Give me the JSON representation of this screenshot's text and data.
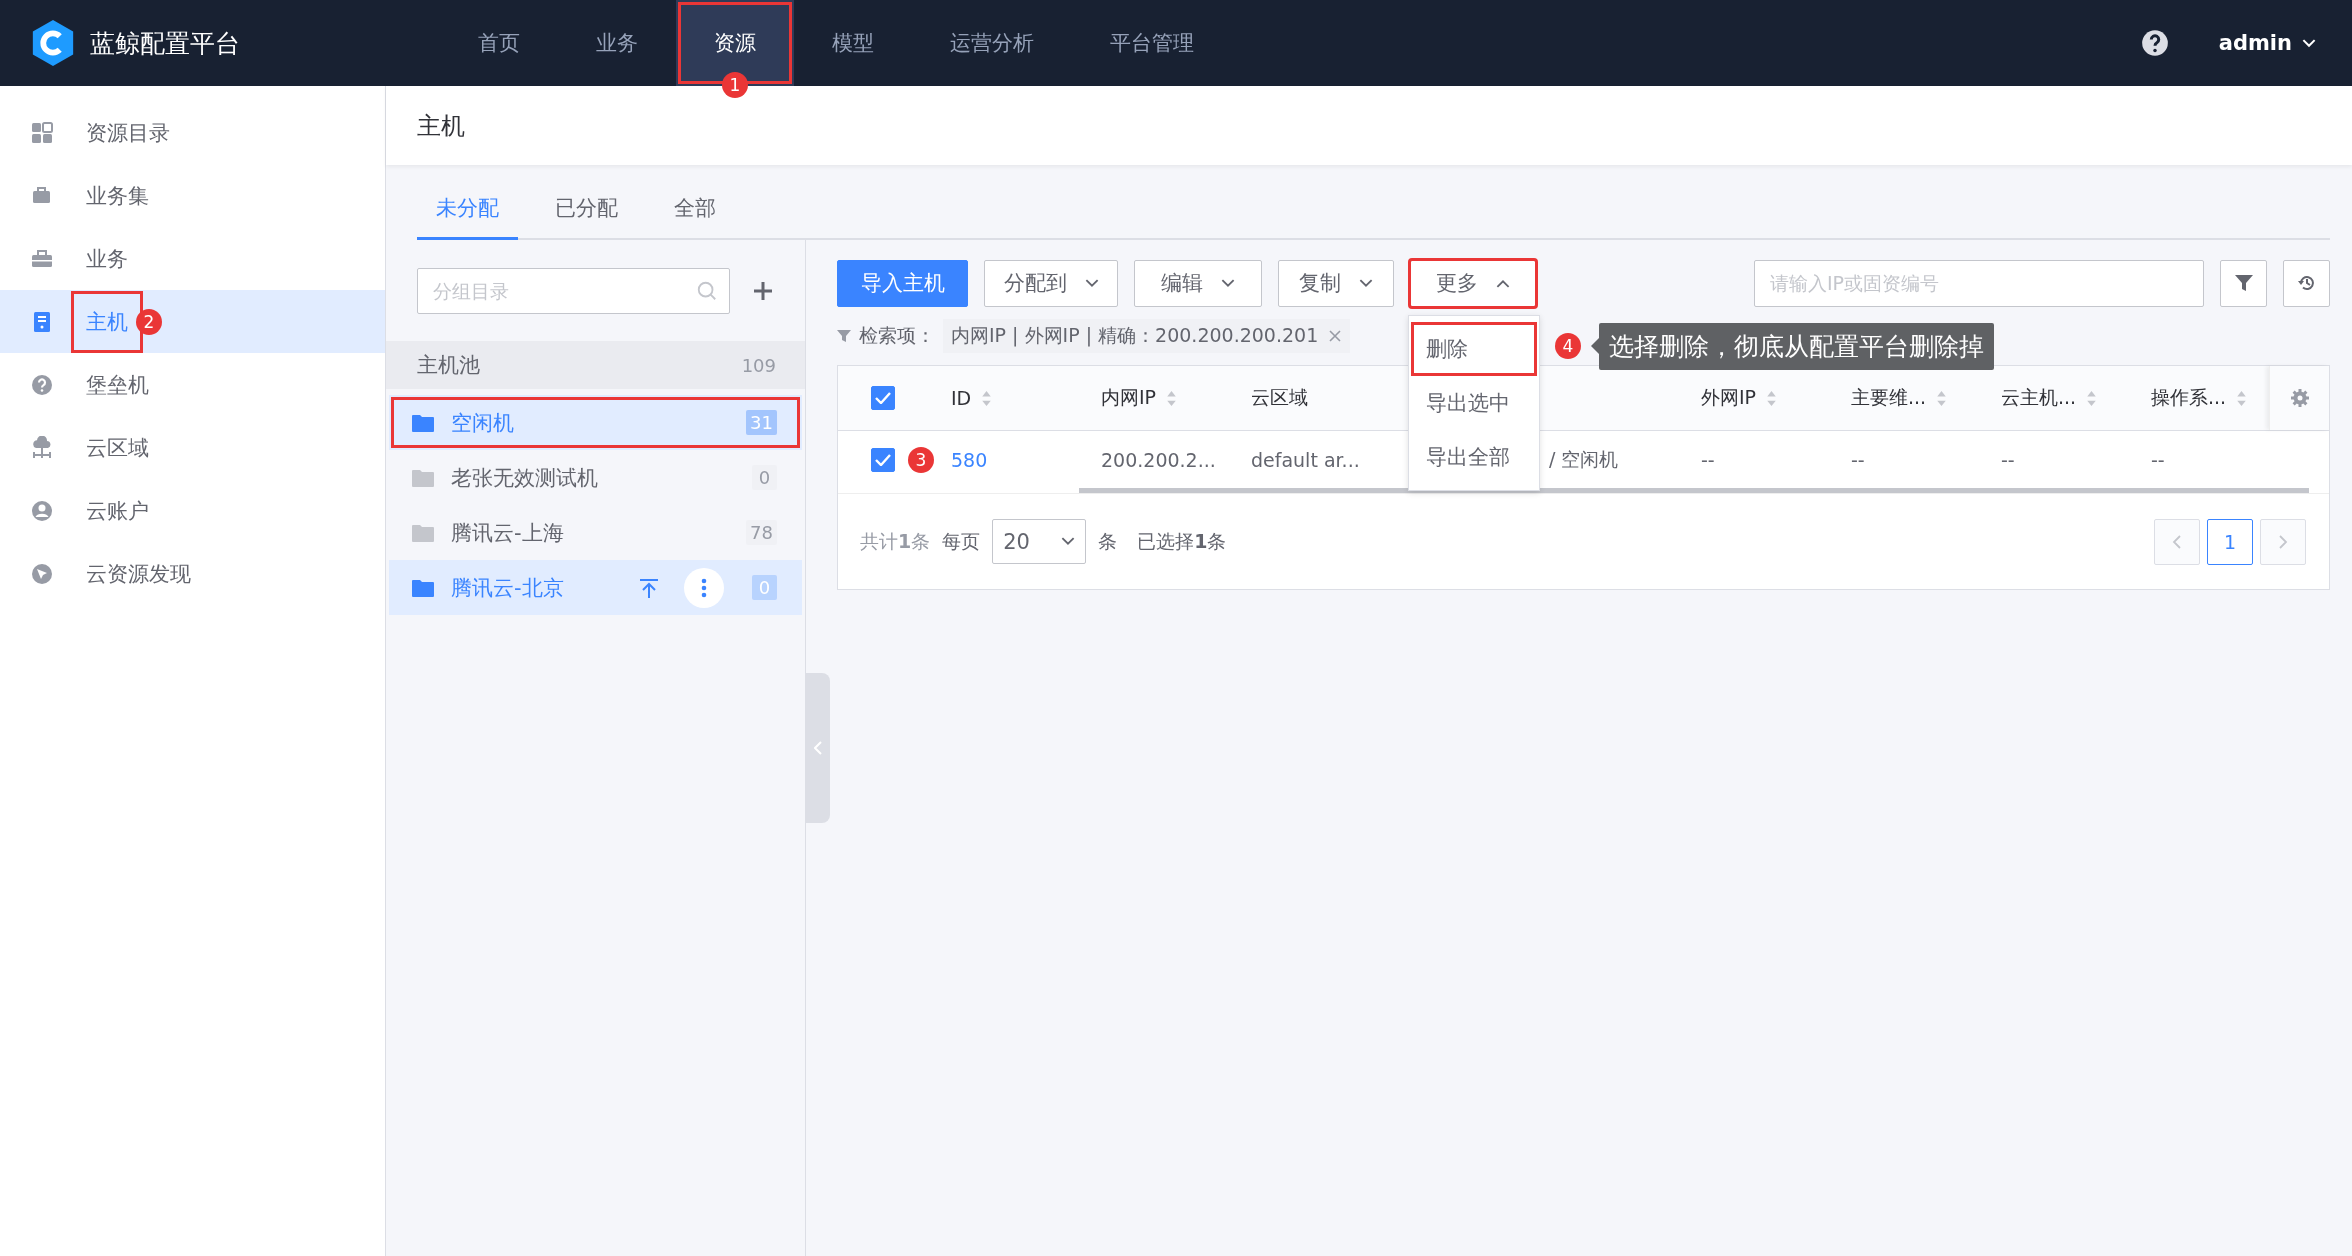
{
  "brand": {
    "title": "蓝鲸配置平台"
  },
  "nav": [
    {
      "label": "首页",
      "selected": false,
      "highlighted": false
    },
    {
      "label": "业务",
      "selected": false,
      "highlighted": false
    },
    {
      "label": "资源",
      "selected": true,
      "highlighted": true,
      "marker": "1"
    },
    {
      "label": "模型",
      "selected": false,
      "highlighted": false
    },
    {
      "label": "运营分析",
      "selected": false,
      "highlighted": false
    },
    {
      "label": "平台管理",
      "selected": false,
      "highlighted": false
    }
  ],
  "user": {
    "name": "admin"
  },
  "sidebar": {
    "items": [
      {
        "label": "资源目录",
        "selected": false,
        "highlighted": false
      },
      {
        "label": "业务集",
        "selected": false,
        "highlighted": false
      },
      {
        "label": "业务",
        "selected": false,
        "highlighted": false
      },
      {
        "label": "主机",
        "selected": true,
        "highlighted": true,
        "marker": "2"
      },
      {
        "label": "堡垒机",
        "selected": false,
        "highlighted": false
      },
      {
        "label": "云区域",
        "selected": false,
        "highlighted": false
      },
      {
        "label": "云账户",
        "selected": false,
        "highlighted": false
      },
      {
        "label": "云资源发现",
        "selected": false,
        "highlighted": false
      }
    ]
  },
  "page": {
    "title": "主机"
  },
  "tabs": [
    {
      "label": "未分配",
      "selected": true
    },
    {
      "label": "已分配",
      "selected": false
    },
    {
      "label": "全部",
      "selected": false
    }
  ],
  "groups": {
    "search": {
      "placeholder": "分组目录"
    },
    "pool": {
      "label": "主机池",
      "count": "109"
    },
    "items": [
      {
        "label": "空闲机",
        "count": "31",
        "selected": true,
        "hovered": false,
        "highlighted": true
      },
      {
        "label": "老张无效测试机",
        "count": "0",
        "selected": false,
        "hovered": false,
        "highlighted": false
      },
      {
        "label": "腾讯云-上海",
        "count": "78",
        "selected": false,
        "hovered": false,
        "highlighted": false
      },
      {
        "label": "腾讯云-北京",
        "count": "0",
        "selected": false,
        "hovered": true,
        "highlighted": false
      }
    ]
  },
  "toolbar": {
    "buttons": [
      {
        "label": "导入主机",
        "kind": "primary",
        "highlighted": false
      },
      {
        "label": "分配到",
        "kind": "dropdown",
        "expanded": false,
        "highlighted": false
      },
      {
        "label": "编辑",
        "kind": "dropdown",
        "expanded": false,
        "highlighted": false
      },
      {
        "label": "复制",
        "kind": "dropdown",
        "expanded": false,
        "highlighted": false
      },
      {
        "label": "更多",
        "kind": "dropdown",
        "expanded": true,
        "highlighted": true
      }
    ],
    "search": {
      "placeholder": "请输入IP或固资编号"
    }
  },
  "menu": {
    "items": [
      {
        "label": "删除",
        "highlighted": true
      },
      {
        "label": "导出选中",
        "highlighted": false
      },
      {
        "label": "导出全部",
        "highlighted": false
      }
    ]
  },
  "callout": {
    "marker": "4",
    "text": "选择删除，彻底从配置平台删除掉"
  },
  "filter": {
    "label": "检索项：",
    "tag": "内网IP | 外网IP | 精确：200.200.200.201"
  },
  "table": {
    "all_checked": true,
    "columns": [
      {
        "label": "ID",
        "sortable": true
      },
      {
        "label": "内网IP",
        "sortable": true
      },
      {
        "label": "云区域",
        "sortable": false
      },
      null,
      {
        "label": "外网IP",
        "sortable": true
      },
      {
        "label": "主要维...",
        "sortable": true
      },
      {
        "label": "云主机...",
        "sortable": true
      },
      {
        "label": "操作系...",
        "sortable": true
      }
    ],
    "rows": [
      {
        "checked": true,
        "marker": "3",
        "cells": [
          "580",
          "200.200.2...",
          "default ar...",
          "/ 空闲机",
          "--",
          "--",
          "--",
          "--"
        ]
      }
    ]
  },
  "pagination": {
    "total": "共计**1**条",
    "per_page_label": "每页",
    "per_page": "20",
    "per_page_unit": "条",
    "selected_count": "已选择**1**条",
    "pages": [
      {
        "label": "1",
        "selected": true
      }
    ]
  }
}
